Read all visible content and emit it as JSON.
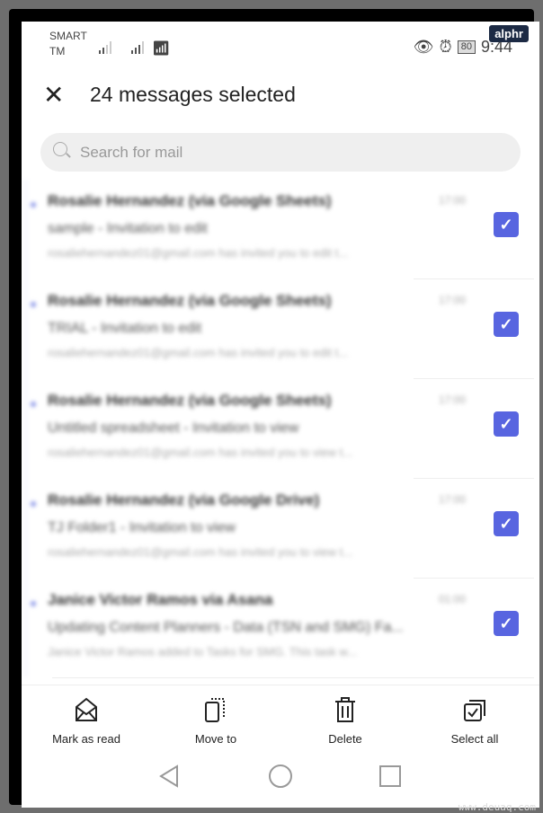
{
  "watermark_badge": "alphr",
  "watermark_url": "www.deuaq.com",
  "status_bar": {
    "carrier_line1": "SMART",
    "carrier_line2": "TM",
    "battery": "80",
    "time": "9:44"
  },
  "header": {
    "title": "24 messages selected",
    "close_icon": "close-icon"
  },
  "search": {
    "placeholder": "Search for mail"
  },
  "accent_color": "#5865e0",
  "messages": [
    {
      "sender": "Rosalie Hernandez (via Google Sheets)",
      "time": "17:00",
      "subject": "sample - Invitation to edit",
      "preview": "rosaliehernandez01@gmail.com has invited you to edit t...",
      "selected": true
    },
    {
      "sender": "Rosalie Hernandez (via Google Sheets)",
      "time": "17:00",
      "subject": "TRIAL - Invitation to edit",
      "preview": "rosaliehernandez01@gmail.com has invited you to edit t...",
      "selected": true
    },
    {
      "sender": "Rosalie Hernandez (via Google Sheets)",
      "time": "17:00",
      "subject": "Untitled spreadsheet - Invitation to view",
      "preview": "rosaliehernandez01@gmail.com has invited you to view t...",
      "selected": true
    },
    {
      "sender": "Rosalie Hernandez (via Google Drive)",
      "time": "17:00",
      "subject": "TJ Folder1 - Invitation to view",
      "preview": "rosaliehernandez01@gmail.com has invited you to view t...",
      "selected": true
    },
    {
      "sender": "Janice Victor Ramos via Asana",
      "time": "01:00",
      "subject": "Updating Content Planners - Data (TSN and SMG) Fa...",
      "preview": "Janice Victor Ramos added to Tasks for SMG. This task w...",
      "selected": true
    }
  ],
  "actions": [
    {
      "label": "Mark as read",
      "icon": "envelope-open-icon"
    },
    {
      "label": "Move to",
      "icon": "move-icon"
    },
    {
      "label": "Delete",
      "icon": "trash-icon"
    },
    {
      "label": "Select all",
      "icon": "select-all-icon"
    }
  ]
}
